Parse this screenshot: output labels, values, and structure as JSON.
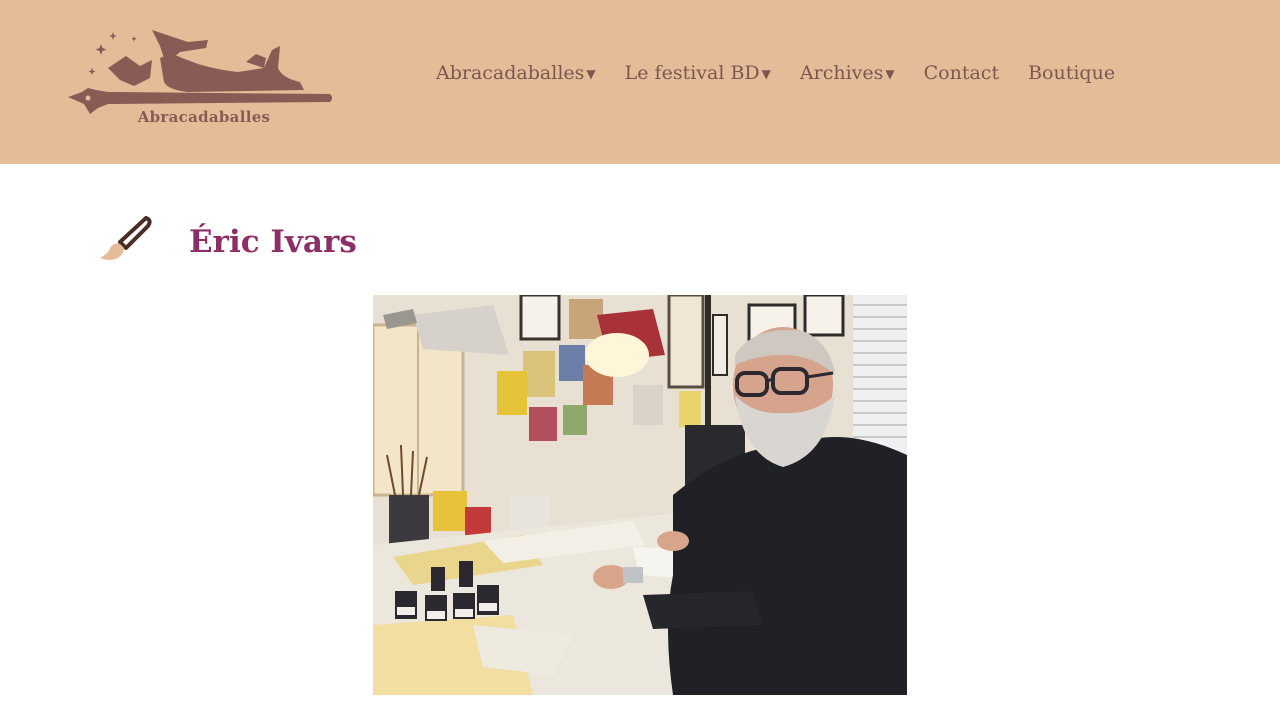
{
  "header": {
    "logo_text": "Abracadaballes",
    "colors": {
      "background": "#e4bd98",
      "logo": "#8a5a54",
      "nav_text": "#7d5650"
    }
  },
  "nav": {
    "items": [
      {
        "label": "Abracadaballes",
        "has_dropdown": true,
        "caret": "caret-down-icon"
      },
      {
        "label": "Le festival BD",
        "has_dropdown": true,
        "caret": "caret-down-icon"
      },
      {
        "label": "Archives",
        "has_dropdown": true,
        "caret": "caret-down-icon"
      },
      {
        "label": "Contact",
        "has_dropdown": false
      },
      {
        "label": "Boutique",
        "has_dropdown": false
      }
    ]
  },
  "main": {
    "title_icon": "paintbrush-icon",
    "title": "Éric Ivars",
    "title_color": "#8c2f66"
  }
}
